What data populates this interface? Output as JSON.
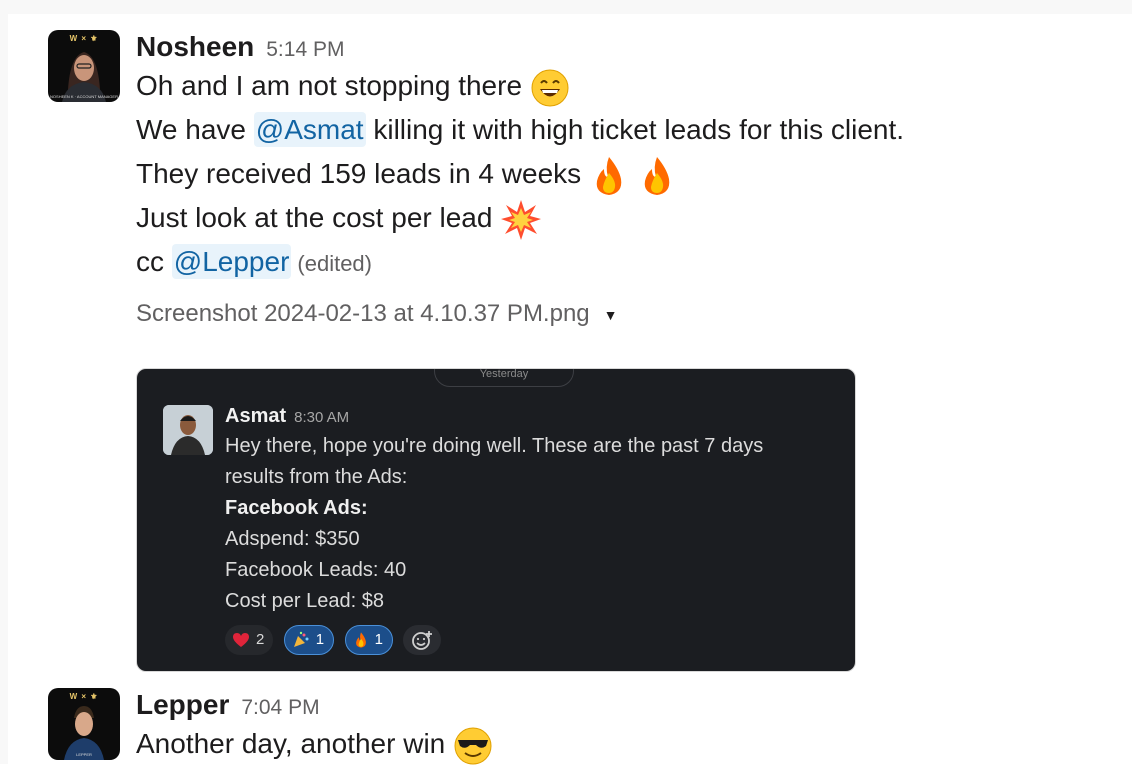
{
  "messages": [
    {
      "author": "Nosheen",
      "time": "5:14 PM",
      "avatar": {
        "caption": "NOSHEEN K · ACCOUNT MANAGER"
      },
      "lines": {
        "l1": "Oh and I am not stopping there",
        "l2_pre": "We have ",
        "l2_mention": "@Asmat",
        "l2_post": " killing it with high ticket leads for this client.",
        "l3": "They received 159 leads in 4 weeks",
        "l4": "Just look at the cost per lead",
        "l5_pre": "cc ",
        "l5_mention": "@Lepper",
        "edited": "(edited)"
      },
      "emojis": [
        "grinning-face",
        "fire",
        "fire",
        "collision"
      ],
      "attachment": {
        "filename": "Screenshot 2024-02-13 at 4.10.37 PM.png",
        "screenshot": {
          "pill_label": "Yesterday",
          "author": "Asmat",
          "time": "8:30 AM",
          "lines": [
            "Hey there, hope you're doing well. These are the past 7 days",
            "results from the Ads:",
            "Facebook Ads:",
            "Adspend: $350",
            "Facebook Leads: 40",
            "Cost per Lead: $8"
          ],
          "reactions": [
            {
              "emoji": "heart",
              "count": "2",
              "active": false
            },
            {
              "emoji": "party-popper",
              "count": "1",
              "active": true
            },
            {
              "emoji": "fire",
              "count": "1",
              "active": true
            }
          ]
        }
      }
    },
    {
      "author": "Lepper",
      "time": "7:04 PM",
      "avatar": {
        "caption": "LEPPER"
      },
      "lines": {
        "l1": "Another day, another win"
      },
      "emojis": [
        "smiling-face-with-sunglasses"
      ]
    }
  ],
  "colors": {
    "mention_bg": "#e8f3fb",
    "mention_text": "#1264a3",
    "reaction_active": "#1c4e8a"
  }
}
